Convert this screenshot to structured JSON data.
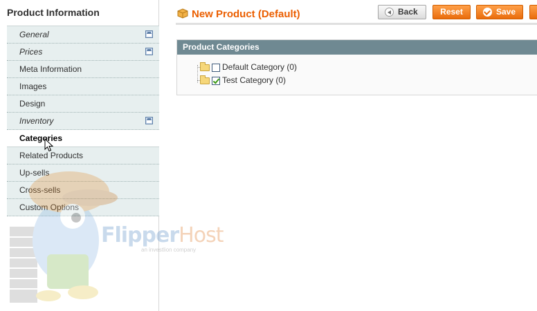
{
  "sidebar": {
    "title": "Product Information",
    "tabs": [
      {
        "label": "General",
        "italic": true,
        "icon": "save-icon"
      },
      {
        "label": "Prices",
        "italic": true,
        "icon": "save-icon"
      },
      {
        "label": "Meta Information"
      },
      {
        "label": "Images"
      },
      {
        "label": "Design"
      },
      {
        "label": "Inventory",
        "italic": true,
        "icon": "save-icon"
      },
      {
        "label": "Categories",
        "active": true
      },
      {
        "label": "Related Products"
      },
      {
        "label": "Up-sells"
      },
      {
        "label": "Cross-sells"
      },
      {
        "label": "Custom Options"
      }
    ]
  },
  "watermark": {
    "brand_a": "Flipper",
    "brand_b": "Host",
    "tagline": "an investlion company"
  },
  "header": {
    "title": "New Product (Default)",
    "icon": "box-icon",
    "buttons": {
      "back": "Back",
      "reset": "Reset",
      "save": "Save"
    }
  },
  "categories": {
    "heading": "Product Categories",
    "items": [
      {
        "label": "Default Category (0)",
        "checked": false
      },
      {
        "label": "Test Category (0)",
        "checked": true
      }
    ]
  },
  "colors": {
    "accent_orange": "#eb5e00",
    "section_header": "#6f8992",
    "tab_bg": "#e7efef"
  }
}
